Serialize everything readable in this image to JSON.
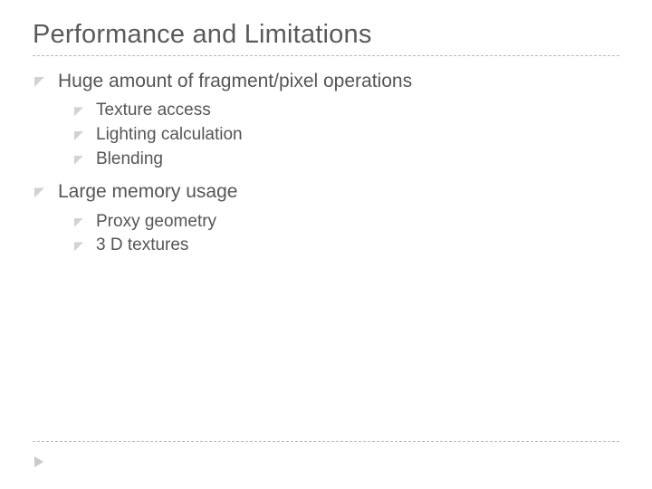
{
  "title": "Performance and Limitations",
  "bullets": [
    {
      "text": "Huge amount of fragment/pixel operations",
      "children": [
        "Texture access",
        "Lighting calculation",
        "Blending"
      ]
    },
    {
      "text": "Large memory usage",
      "children": [
        "Proxy geometry",
        "3 D textures"
      ]
    }
  ]
}
